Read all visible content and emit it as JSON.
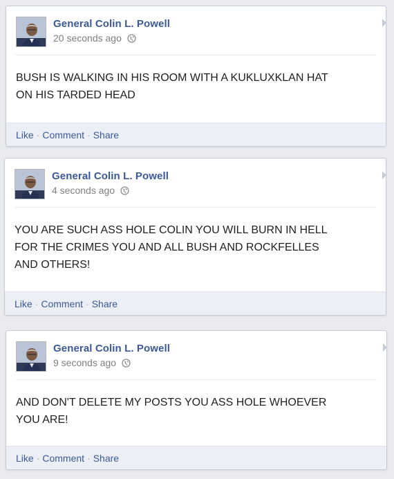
{
  "posts": [
    {
      "author": "General Colin L. Powell",
      "time": "20 seconds ago",
      "text": "BUSH IS WALKING IN HIS ROOM WITH A KUKLUXKLAN HAT\nON HIS TARDED HEAD",
      "actions": {
        "like": "Like",
        "comment": "Comment",
        "share": "Share",
        "sep": "·"
      },
      "icons": {
        "avatar": "avatar-photo",
        "audience": "globe-icon"
      }
    },
    {
      "author": "General Colin L. Powell",
      "time": "4 seconds ago",
      "text": "YOU ARE SUCH ASS HOLE COLIN YOU WILL BURN IN HELL\nFOR THE CRIMES YOU AND ALL BUSH AND ROCKFELLES\nAND OTHERS!",
      "actions": {
        "like": "Like",
        "comment": "Comment",
        "share": "Share",
        "sep": "·"
      },
      "icons": {
        "avatar": "avatar-photo",
        "audience": "globe-icon"
      }
    },
    {
      "author": "General Colin L. Powell",
      "time": "9 seconds ago",
      "text": "AND DON'T DELETE MY POSTS YOU ASS HOLE WHOEVER\nYOU ARE!",
      "actions": {
        "like": "Like",
        "comment": "Comment",
        "share": "Share",
        "sep": "·"
      },
      "icons": {
        "avatar": "avatar-photo",
        "audience": "globe-icon"
      }
    }
  ],
  "colors": {
    "link": "#3b5998",
    "background": "#e9ebee",
    "action_bar": "#eceff5"
  }
}
